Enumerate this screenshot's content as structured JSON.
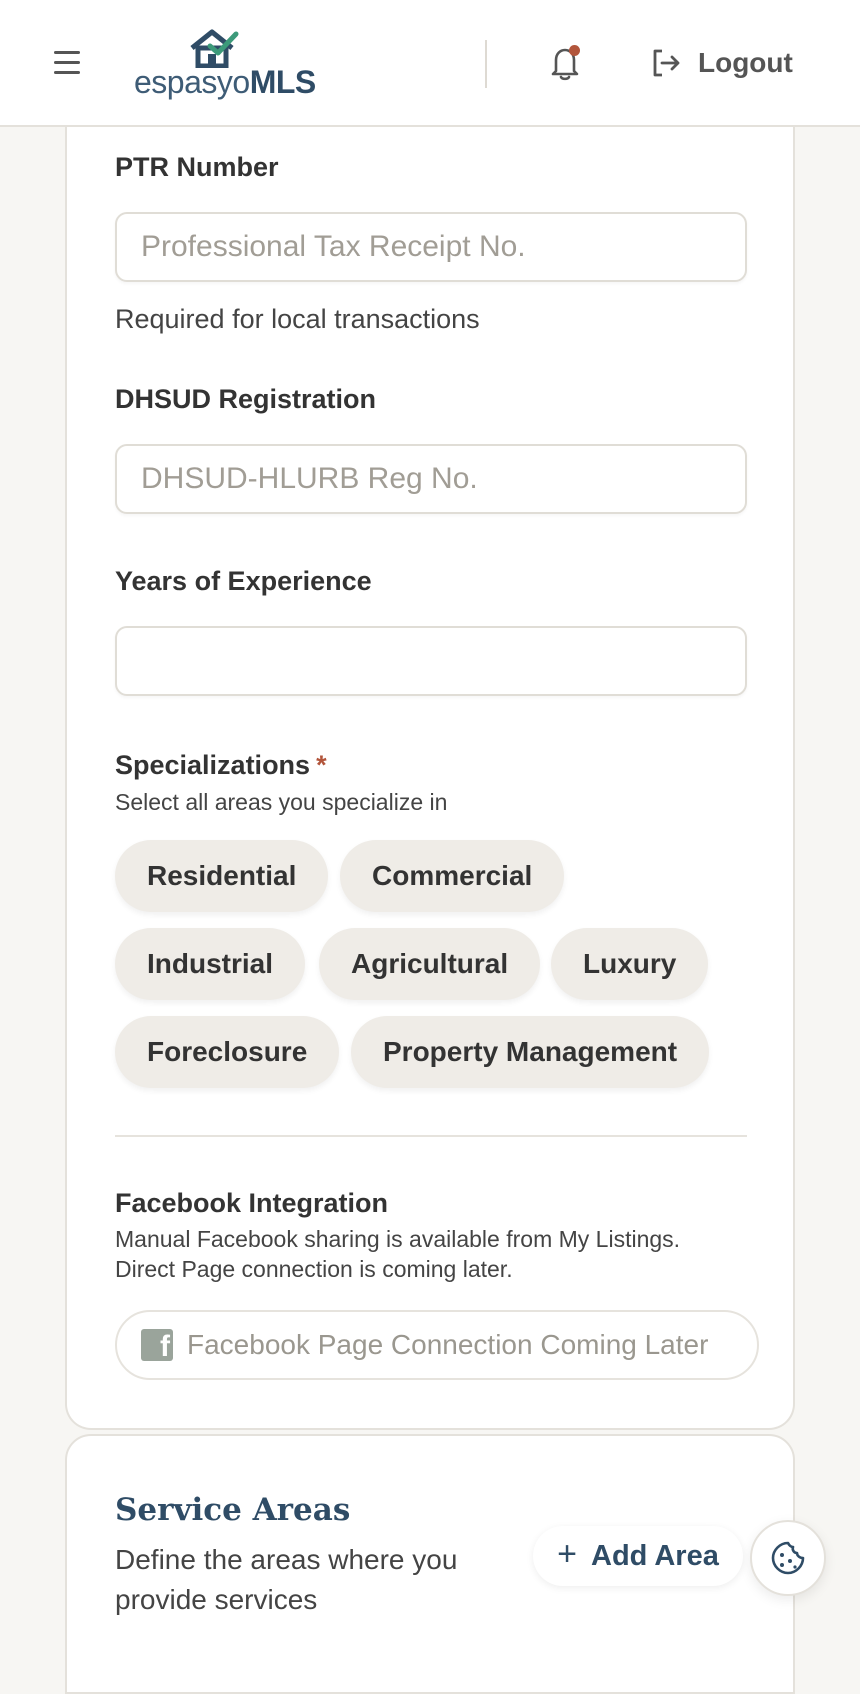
{
  "header": {
    "logo_text_regular": "espasyo",
    "logo_text_bold": "MLS",
    "logout_label": "Logout"
  },
  "form": {
    "ptr": {
      "label": "PTR Number",
      "placeholder": "Professional Tax Receipt No.",
      "value": "",
      "help": "Required for local transactions"
    },
    "dhsud": {
      "label": "DHSUD Registration",
      "placeholder": "DHSUD-HLURB Reg No.",
      "value": ""
    },
    "experience": {
      "label": "Years of Experience",
      "value": ""
    },
    "specializations": {
      "label": "Specializations",
      "required_mark": "*",
      "subtitle": "Select all areas you specialize in",
      "options": [
        "Residential",
        "Commercial",
        "Industrial",
        "Agricultural",
        "Luxury",
        "Foreclosure",
        "Property Management"
      ]
    },
    "facebook": {
      "label": "Facebook Integration",
      "desc_line1": "Manual Facebook sharing is available from My Listings.",
      "desc_line2": "Direct Page connection is coming later.",
      "button_label": "Facebook Page Connection Coming Later"
    }
  },
  "service_areas": {
    "title": "Service Areas",
    "description": "Define the areas where you provide services",
    "add_label": "Add Area"
  },
  "colors": {
    "brand": "#2f4c66",
    "accent": "#b2553b",
    "chip_bg": "#efece7",
    "page_bg": "#f7f6f3"
  },
  "icons": {
    "menu": "hamburger-menu-icon",
    "notifications": "bell-icon",
    "logout": "logout-icon",
    "facebook": "facebook-icon",
    "add": "plus-icon",
    "cookie": "cookie-icon"
  }
}
